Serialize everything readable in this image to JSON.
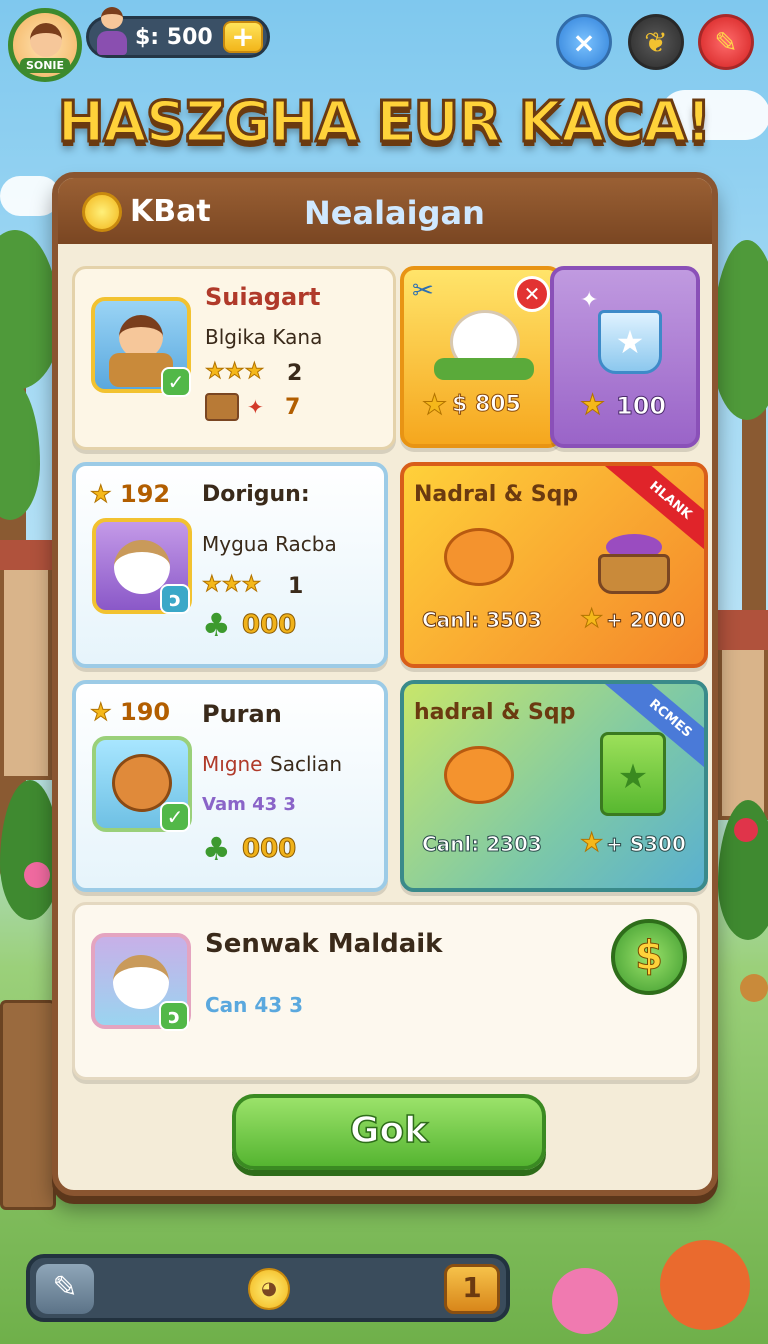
{
  "hud": {
    "player_name": "SONIE",
    "coins": "$: 500",
    "plus_label": "+",
    "close_icon": "×",
    "edit_icon": "✎",
    "leaf_icon": "❦"
  },
  "title": "HASZGHA EUR KACA!",
  "panel": {
    "header_left": "KBat",
    "header_title": "Nealaigan"
  },
  "row1": {
    "name": "Suiagart",
    "sub": "Blgika Kana",
    "stars": "★★★",
    "stars_count": "2",
    "extra": "7",
    "item1_price": "$ 805",
    "item2_price": "100"
  },
  "row2": {
    "points": "192",
    "name": "Dorigun:",
    "sub": "Mygua Racba",
    "stars": "★★★",
    "stars_count": "1",
    "clover_value": "000",
    "offer_title": "Nadral & Sqp",
    "offer_badge": "HLANK",
    "offer_cost": "Canl: 3503",
    "offer_reward": "+ 2000"
  },
  "row3": {
    "points": "190",
    "name": "Puran",
    "sub_a": "Mıgne",
    "sub_b": "Saclian",
    "info": "Vam 43 3",
    "clover_value": "000",
    "offer_title": "hadral & Sqp",
    "offer_badge": "RCMES",
    "offer_cost": "Canl: 2303",
    "offer_reward": "+ S300"
  },
  "row4": {
    "name": "Senwak Maldaik",
    "info": "Can 43 3",
    "dollar_icon": "$"
  },
  "gok_button": "Gok",
  "bottom": {
    "pencil_icon": "✎",
    "count": "1"
  },
  "colors": {
    "panel_bg": "#f4ecd8",
    "panel_border": "#8a5530",
    "accent_green": "#55b531",
    "title_yellow": "#ffd23a"
  }
}
